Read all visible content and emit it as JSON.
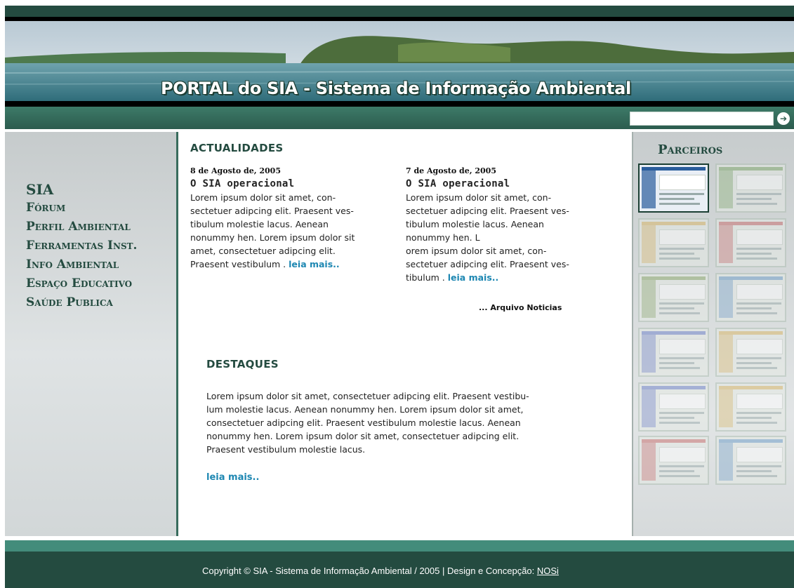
{
  "header": {
    "title": "PORTAL do SIA - Sistema de Informação Ambiental",
    "search": {
      "value": "",
      "button_icon": "arrow-right-circle-icon"
    }
  },
  "nav": {
    "items": [
      {
        "label": "SIA"
      },
      {
        "label": "Fórum"
      },
      {
        "label": "Perfil Ambiental"
      },
      {
        "label": "Ferramentas Inst."
      },
      {
        "label": "Info Ambiental"
      },
      {
        "label": "Espaço Educativo"
      },
      {
        "label": "Saúde Publica"
      }
    ]
  },
  "actualidades": {
    "heading": "ACTUALIDADES",
    "news": [
      {
        "date": "8 de Agosto de, 2005",
        "title": "O SIA operacional",
        "lines": [
          "Lorem ipsum dolor sit amet, con-",
          "sectetuer adipcing elit. Praesent ves-",
          "tibulum molestie lacus. Aenean",
          "nonummy hen.  Lorem ipsum dolor sit",
          "amet, consectetuer adipcing elit.",
          "Praesent vestibulum . "
        ],
        "more": "leia mais.."
      },
      {
        "date": "7 de Agosto de, 2005",
        "title": "O SIA operacional",
        "lines": [
          "Lorem ipsum dolor sit amet, con-",
          "sectetuer adipcing elit. Praesent ves-",
          "tibulum molestie lacus. Aenean",
          "nonummy hen.  L",
          "orem ipsum dolor sit amet, con-",
          "sectetuer adipcing elit. Praesent ves-",
          "tibulum . "
        ],
        "more": "leia mais.."
      }
    ],
    "archive_link": "... Arquivo Noticias"
  },
  "destaques": {
    "heading": "DESTAQUES",
    "lines": [
      "Lorem ipsum dolor sit amet, consectetuer adipcing elit. Praesent vestibu-",
      "lum molestie lacus. Aenean nonummy hen.  Lorem ipsum dolor sit amet,",
      "consectetuer adipcing elit. Praesent vestibulum molestie lacus. Aenean",
      "nonummy hen.  Lorem ipsum dolor sit amet, consectetuer adipcing elit.",
      "Praesent vestibulum molestie lacus."
    ],
    "more": "leia mais.."
  },
  "partners": {
    "heading": "Parceiros",
    "thumbs": [
      {
        "active": true,
        "accent": "#2a5d9c"
      },
      {
        "active": false,
        "accent": "#7ea86a"
      },
      {
        "active": false,
        "accent": "#d9b562"
      },
      {
        "active": false,
        "accent": "#c86a6a"
      },
      {
        "active": false,
        "accent": "#8aa86a"
      },
      {
        "active": false,
        "accent": "#6a9ac8"
      },
      {
        "active": false,
        "accent": "#6a7ec8"
      },
      {
        "active": false,
        "accent": "#d9b562"
      },
      {
        "active": false,
        "accent": "#6a7ec8"
      },
      {
        "active": false,
        "accent": "#d9b562"
      },
      {
        "active": false,
        "accent": "#c86a6a"
      },
      {
        "active": false,
        "accent": "#6a9ac8"
      }
    ]
  },
  "footer": {
    "copyright": "Copyright © SIA - Sistema de Informação Ambiental /  2005 | Design e Concepção: ",
    "credit": "NOSi"
  },
  "colors": {
    "primary": "#244b40",
    "accent_link": "#1d87b2",
    "footer_band": "#438c7b"
  }
}
